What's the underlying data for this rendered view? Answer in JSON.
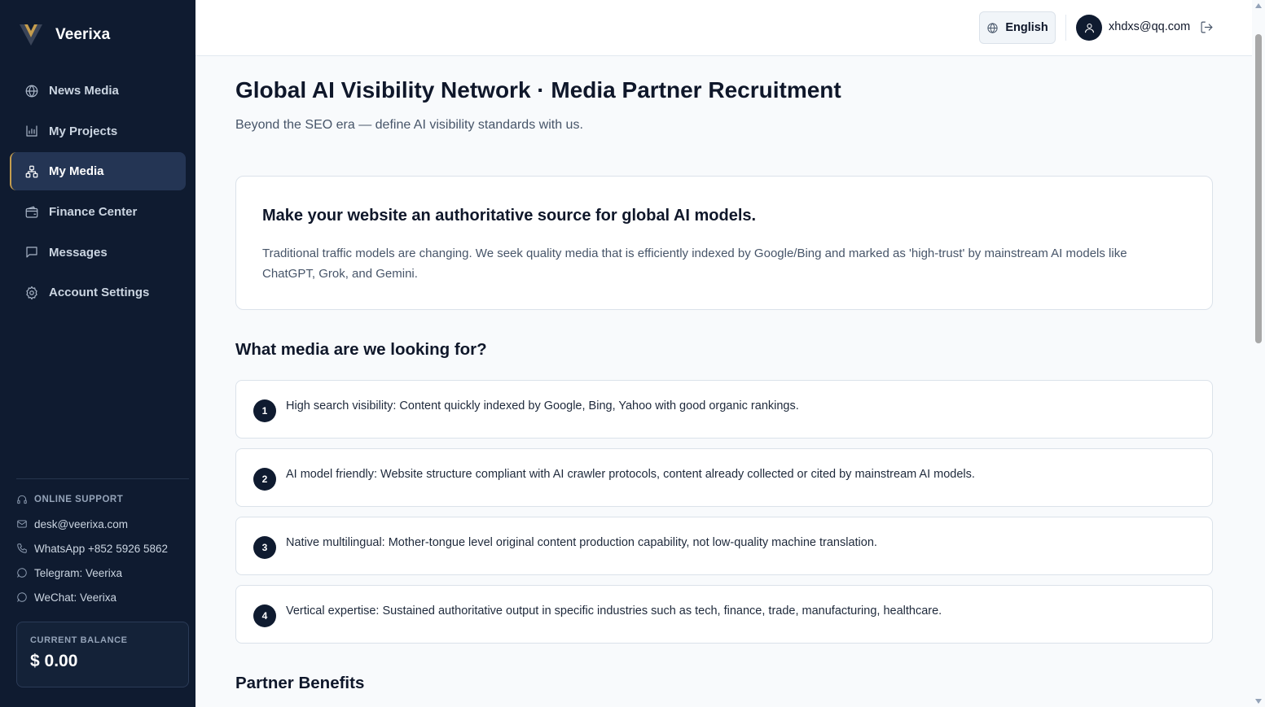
{
  "app": {
    "name": "Veerixa"
  },
  "sidebar": {
    "items": [
      {
        "label": "News Media",
        "icon": "globe-icon",
        "active": false
      },
      {
        "label": "My Projects",
        "icon": "chart-icon",
        "active": false
      },
      {
        "label": "My Media",
        "icon": "network-icon",
        "active": true
      },
      {
        "label": "Finance Center",
        "icon": "wallet-icon",
        "active": false
      },
      {
        "label": "Messages",
        "icon": "message-icon",
        "active": false
      },
      {
        "label": "Account Settings",
        "icon": "gear-icon",
        "active": false
      }
    ],
    "support": {
      "title": "ONLINE SUPPORT",
      "email": "desk@veerixa.com",
      "whatsapp": "WhatsApp +852 5926 5862",
      "telegram": "Telegram: Veerixa",
      "wechat": "WeChat: Veerixa"
    },
    "balance": {
      "label": "CURRENT BALANCE",
      "value": "$ 0.00"
    }
  },
  "header": {
    "language": "English",
    "user_email": "xhdxs@qq.com"
  },
  "main": {
    "title": "Global AI Visibility Network · Media Partner Recruitment",
    "subtitle": "Beyond the SEO era — define AI visibility standards with us.",
    "intro": {
      "heading": "Make your website an authoritative source for global AI models.",
      "text": "Traditional traffic models are changing. We seek quality media that is efficiently indexed by Google/Bing and marked as 'high-trust' by mainstream AI models like ChatGPT, Grok, and Gemini."
    },
    "looking_for_title": "What media are we looking for?",
    "requirements": [
      {
        "num": "1",
        "text": "High search visibility: Content quickly indexed by Google, Bing, Yahoo with good organic rankings."
      },
      {
        "num": "2",
        "text": "AI model friendly: Website structure compliant with AI crawler protocols, content already collected or cited by mainstream AI models."
      },
      {
        "num": "3",
        "text": "Native multilingual: Mother-tongue level original content production capability, not low-quality machine translation."
      },
      {
        "num": "4",
        "text": "Vertical expertise: Sustained authoritative output in specific industries such as tech, finance, trade, manufacturing, healthcare."
      }
    ],
    "benefits_title": "Partner Benefits"
  },
  "colors": {
    "sidebar_bg": "#0f1b30",
    "active_item_bg": "#243554",
    "accent": "#c59d4e",
    "page_bg": "#f8fafc"
  }
}
